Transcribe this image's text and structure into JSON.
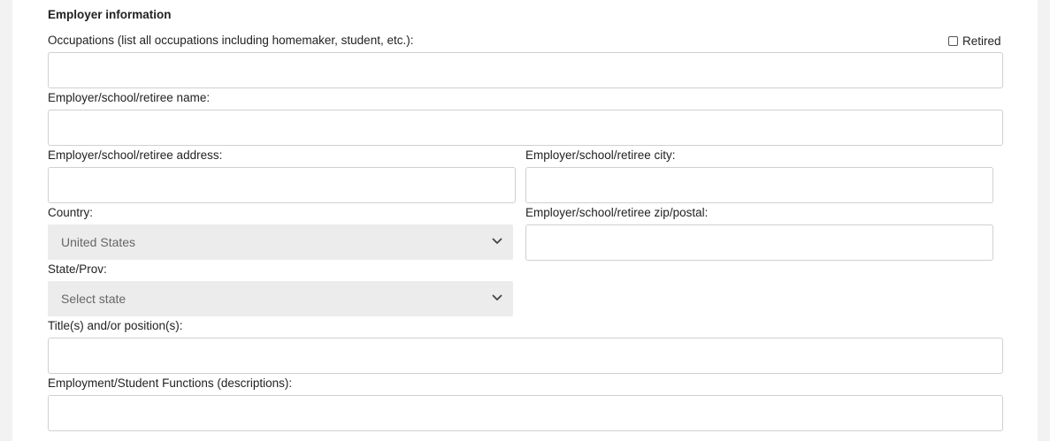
{
  "section": {
    "title": "Employer information"
  },
  "fields": {
    "occupations": {
      "label": "Occupations (list all occupations including homemaker, student, etc.):",
      "value": ""
    },
    "retired": {
      "label": "Retired",
      "checked": false
    },
    "employer_name": {
      "label": "Employer/school/retiree name:",
      "value": ""
    },
    "employer_address": {
      "label": "Employer/school/retiree address:",
      "value": ""
    },
    "employer_city": {
      "label": "Employer/school/retiree city:",
      "value": ""
    },
    "country": {
      "label": "Country:",
      "selected": "United States"
    },
    "zip": {
      "label": "Employer/school/retiree zip/postal:",
      "value": ""
    },
    "state": {
      "label": "State/Prov:",
      "selected": "Select state"
    },
    "titles": {
      "label": "Title(s) and/or position(s):",
      "value": ""
    },
    "functions": {
      "label": "Employment/Student Functions (descriptions):",
      "value": ""
    }
  },
  "icons": {
    "select_arrow": "chevron-down-icon"
  }
}
